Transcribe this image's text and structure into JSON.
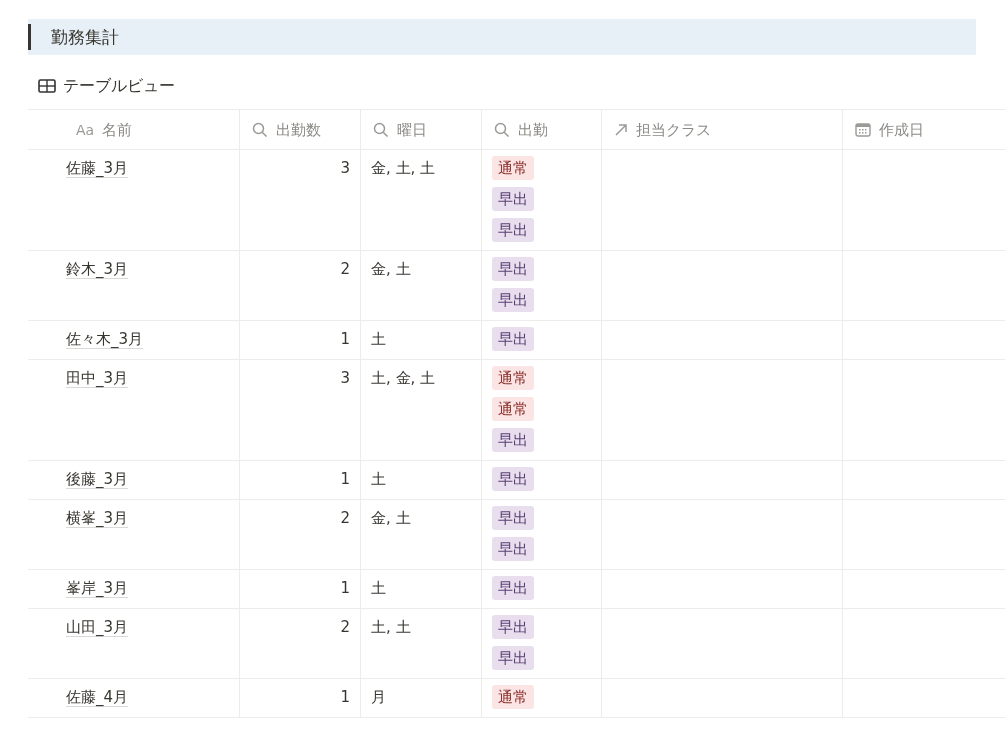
{
  "heading": "勤務集計",
  "view": {
    "title": "テーブルビュー"
  },
  "table": {
    "columns": [
      {
        "label": "名前",
        "kind": "title",
        "icon_text": "Aa"
      },
      {
        "label": "出勤数",
        "kind": "rollup"
      },
      {
        "label": "曜日",
        "kind": "rollup"
      },
      {
        "label": "出勤",
        "kind": "rollup"
      },
      {
        "label": "担当クラス",
        "kind": "relation"
      },
      {
        "label": "作成日",
        "kind": "date"
      }
    ],
    "rows": [
      {
        "name": "佐藤_3月",
        "count": "3",
        "days": "金, 土, 土",
        "tags": [
          {
            "label": "通常",
            "color": "#fbe4e4"
          },
          {
            "label": "早出",
            "color": "#e8deee"
          },
          {
            "label": "早出",
            "color": "#e8deee"
          }
        ]
      },
      {
        "name": "鈴木_3月",
        "count": "2",
        "days": "金, 土",
        "tags": [
          {
            "label": "早出",
            "color": "#e8deee"
          },
          {
            "label": "早出",
            "color": "#e8deee"
          }
        ]
      },
      {
        "name": "佐々木_3月",
        "count": "1",
        "days": "土",
        "tags": [
          {
            "label": "早出",
            "color": "#e8deee"
          }
        ]
      },
      {
        "name": "田中_3月",
        "count": "3",
        "days": "土, 金, 土",
        "tags": [
          {
            "label": "通常",
            "color": "#fbe4e4"
          },
          {
            "label": "通常",
            "color": "#fbe4e4"
          },
          {
            "label": "早出",
            "color": "#e8deee"
          }
        ]
      },
      {
        "name": "後藤_3月",
        "count": "1",
        "days": "土",
        "tags": [
          {
            "label": "早出",
            "color": "#e8deee"
          }
        ]
      },
      {
        "name": "横峯_3月",
        "count": "2",
        "days": "金, 土",
        "tags": [
          {
            "label": "早出",
            "color": "#e8deee"
          },
          {
            "label": "早出",
            "color": "#e8deee"
          }
        ]
      },
      {
        "name": "峯岸_3月",
        "count": "1",
        "days": "土",
        "tags": [
          {
            "label": "早出",
            "color": "#e8deee"
          }
        ]
      },
      {
        "name": "山田_3月",
        "count": "2",
        "days": "土, 土",
        "tags": [
          {
            "label": "早出",
            "color": "#e8deee"
          },
          {
            "label": "早出",
            "color": "#e8deee"
          }
        ]
      },
      {
        "name": "佐藤_4月",
        "count": "1",
        "days": "月",
        "tags": [
          {
            "label": "通常",
            "color": "#fbe4e4"
          }
        ]
      }
    ]
  }
}
